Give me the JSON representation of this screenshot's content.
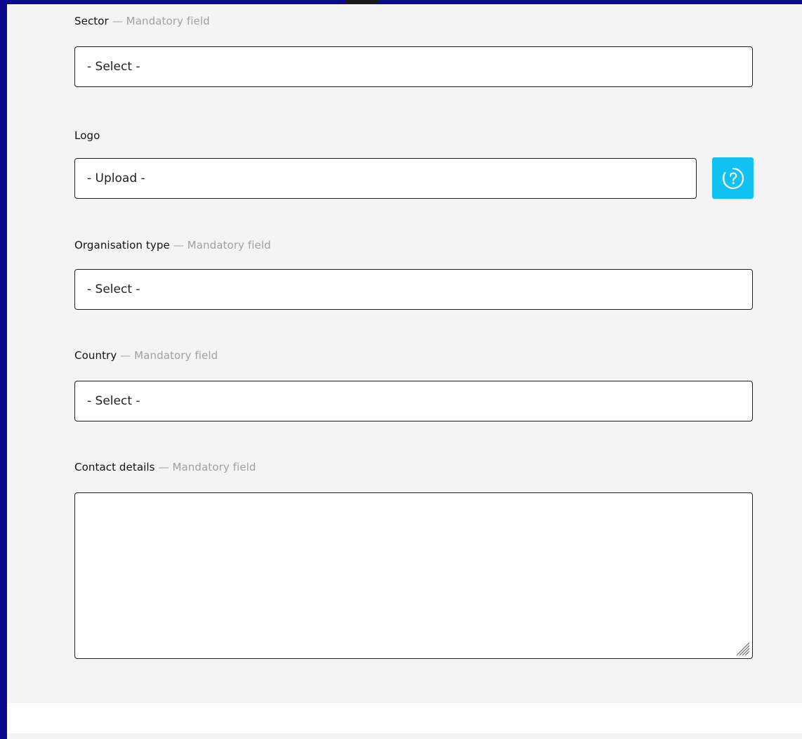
{
  "form": {
    "mandatory_separator": " — ",
    "fields": {
      "sector": {
        "label": "Sector",
        "hint": "Mandatory field",
        "value": "- Select -"
      },
      "logo": {
        "label": "Logo",
        "value": "- Upload -",
        "help_icon": "help-circle-icon"
      },
      "organisation_type": {
        "label": "Organisation type",
        "hint": "Mandatory field",
        "value": "- Select -"
      },
      "country": {
        "label": "Country",
        "hint": "Mandatory field",
        "value": "- Select -"
      },
      "contact_details": {
        "label": "Contact details",
        "hint": "Mandatory field",
        "value": ""
      }
    }
  },
  "colors": {
    "panel_background": "#f4f4f4",
    "frame": "#0a0a8a",
    "field_border": "#1f1f1f",
    "hint_text": "#a0a0a0",
    "help_button": "#11c1f1"
  }
}
